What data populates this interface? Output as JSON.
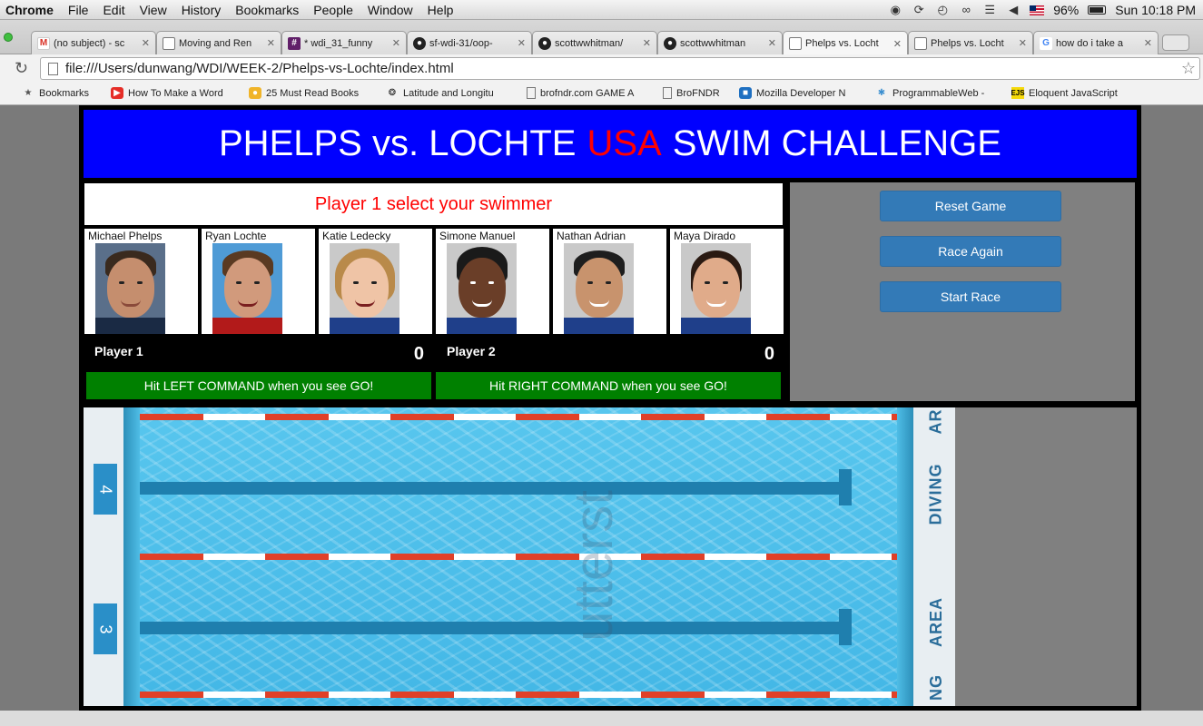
{
  "menubar": {
    "app": "Chrome",
    "items": [
      "File",
      "Edit",
      "View",
      "History",
      "Bookmarks",
      "People",
      "Window",
      "Help"
    ],
    "battery": "96%",
    "clock": "Sun 10:18 PM",
    "icons": [
      "evernote-icon",
      "sync-icon",
      "time-machine-icon",
      "bluetooth-icon",
      "wifi-icon",
      "volume-icon",
      "us-flag-icon",
      "battery-icon"
    ]
  },
  "tabs": [
    {
      "label": "(no subject) - sc",
      "icon": "gmail"
    },
    {
      "label": "Moving and Ren",
      "icon": "page"
    },
    {
      "label": "* wdi_31_funny",
      "icon": "slack"
    },
    {
      "label": "sf-wdi-31/oop-",
      "icon": "github"
    },
    {
      "label": "scottwwhitman/",
      "icon": "github"
    },
    {
      "label": "scottwwhitman",
      "icon": "github"
    },
    {
      "label": "Phelps vs. Locht",
      "icon": "page"
    },
    {
      "label": "Phelps vs. Locht",
      "icon": "page"
    },
    {
      "label": "how do i take a",
      "icon": "google"
    }
  ],
  "address": {
    "url": "file:///Users/dunwang/WDI/WEEK-2/Phelps-vs-Lochte/index.html"
  },
  "bookmarks": {
    "items": [
      {
        "label": "Bookmarks",
        "icon": "star"
      },
      {
        "label": "How To Make a Word",
        "icon": "youtube"
      },
      {
        "label": "25 Must Read Books",
        "icon": "book"
      },
      {
        "label": "Latitude and Longitu",
        "icon": "compass"
      },
      {
        "label": "brofndr.com GAME A",
        "icon": "page"
      },
      {
        "label": "BroFNDR",
        "icon": "page"
      },
      {
        "label": "Mozilla Developer N",
        "icon": "mozilla"
      },
      {
        "label": "ProgrammableWeb -",
        "icon": "gear"
      },
      {
        "label": "Eloquent JavaScript",
        "icon": "ejs"
      }
    ]
  },
  "game": {
    "title_part1": "PHELPS vs. LOCHTE",
    "title_usa": "USA",
    "title_part2": "SWIM CHALLENGE",
    "prompt": "Player 1 select your swimmer",
    "swimmers": [
      {
        "name": "Michael Phelps"
      },
      {
        "name": "Ryan Lochte"
      },
      {
        "name": "Katie Ledecky"
      },
      {
        "name": "Simone Manuel"
      },
      {
        "name": "Nathan Adrian"
      },
      {
        "name": "Maya Dirado"
      }
    ],
    "player1": {
      "label": "Player 1",
      "score": "0",
      "hint": "Hit LEFT COMMAND when you see GO!"
    },
    "player2": {
      "label": "Player 2",
      "score": "0",
      "hint": "Hit RIGHT COMMAND when you see GO!"
    },
    "buttons": {
      "reset": "Reset Game",
      "again": "Race Again",
      "start": "Start Race"
    },
    "pool": {
      "lanes": [
        "4",
        "3"
      ],
      "side_text": [
        "AR",
        "DIVING",
        "AREA",
        "NG"
      ],
      "watermark": "utterst"
    },
    "colors": {
      "header_bg": "#0000ff",
      "usa": "#ff0000",
      "hint_bg": "#008000",
      "button_bg": "#337ab7"
    }
  }
}
